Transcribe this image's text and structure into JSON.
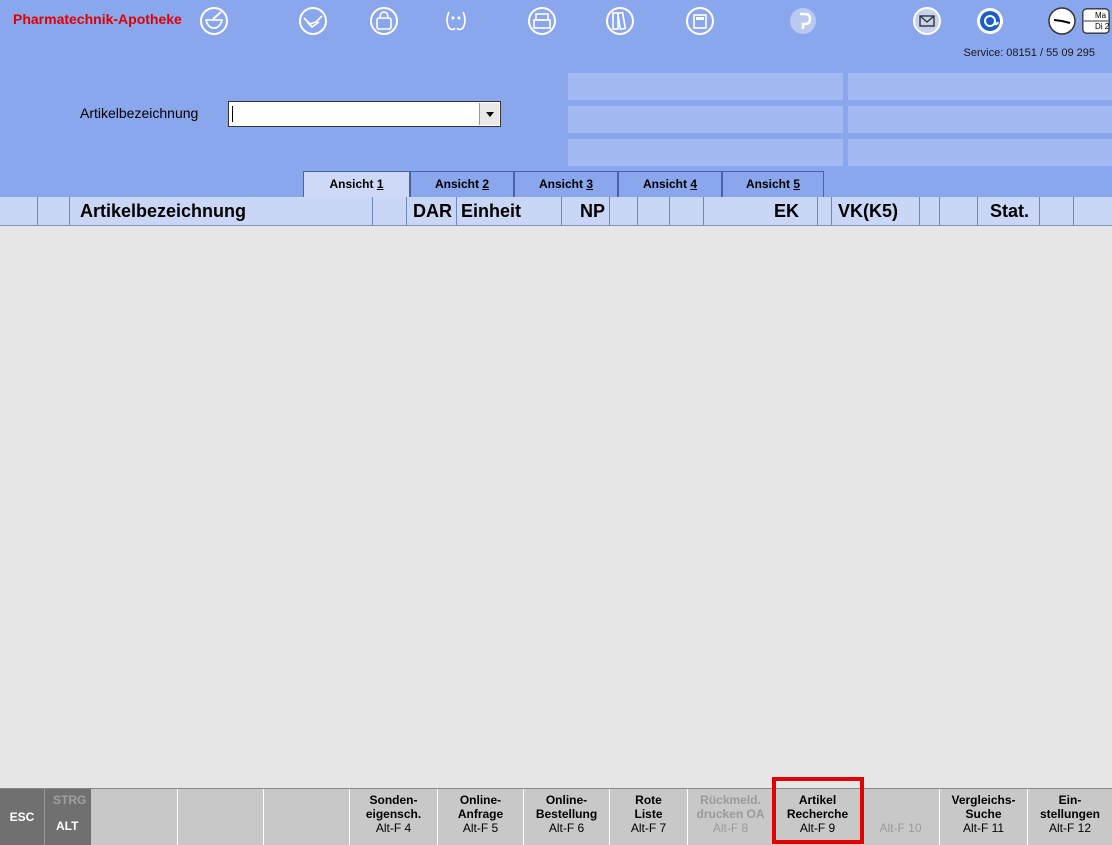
{
  "header": {
    "brand": "Pharmatechnik-Apotheke",
    "service": "Service: 08151 / 55 09 295",
    "toolbar_icons": [
      "mortar-icon",
      "handshake-icon",
      "shopping-bag-icon",
      "faces-icon",
      "printer-icon",
      "binders-icon",
      "calculator-icon",
      "p-logo-icon",
      "mail-icon",
      "at-icon",
      "clock-icon",
      "calendar-icon"
    ],
    "calendar_text": [
      "Ma",
      "Di 2"
    ]
  },
  "search": {
    "label": "Artikelbezeichnung",
    "value": ""
  },
  "tabs": [
    {
      "prefix": "Ansicht ",
      "key": "1"
    },
    {
      "prefix": "Ansicht ",
      "key": "2"
    },
    {
      "prefix": "Ansicht ",
      "key": "3"
    },
    {
      "prefix": "Ansicht ",
      "key": "4"
    },
    {
      "prefix": "Ansicht ",
      "key": "5"
    }
  ],
  "columns": [
    "",
    "",
    "Artikelbezeichnung",
    "",
    "DAR",
    "Einheit",
    "NP",
    "",
    "",
    "",
    "EK",
    "",
    "VK(K5)",
    "",
    "",
    "Stat.",
    ""
  ],
  "fkeys": {
    "esc": "ESC",
    "strg": "STRG",
    "alt": "ALT",
    "keys": [
      {
        "l1": "",
        "l2": "",
        "l3": ""
      },
      {
        "l1": "",
        "l2": "",
        "l3": ""
      },
      {
        "l1": "",
        "l2": "",
        "l3": ""
      },
      {
        "l1": "Sonden-",
        "l2": "eigensch.",
        "l3": "Alt-F 4"
      },
      {
        "l1": "Online-",
        "l2": "Anfrage",
        "l3": "Alt-F 5"
      },
      {
        "l1": "Online-",
        "l2": "Bestellung",
        "l3": "Alt-F 6"
      },
      {
        "l1": "Rote",
        "l2": "Liste",
        "l3": "Alt-F 7"
      },
      {
        "l1": "Rückmeld.",
        "l2": "drucken OA",
        "l3": "Alt-F 8"
      },
      {
        "l1": "Artikel",
        "l2": "Recherche",
        "l3": "Alt-F 9"
      },
      {
        "l1": "",
        "l2": "",
        "l3": "Alt-F 10"
      },
      {
        "l1": "Vergleichs-",
        "l2": "Suche",
        "l3": "Alt-F 11"
      },
      {
        "l1": "Ein-",
        "l2": "stellungen",
        "l3": "Alt-F 12"
      }
    ]
  }
}
